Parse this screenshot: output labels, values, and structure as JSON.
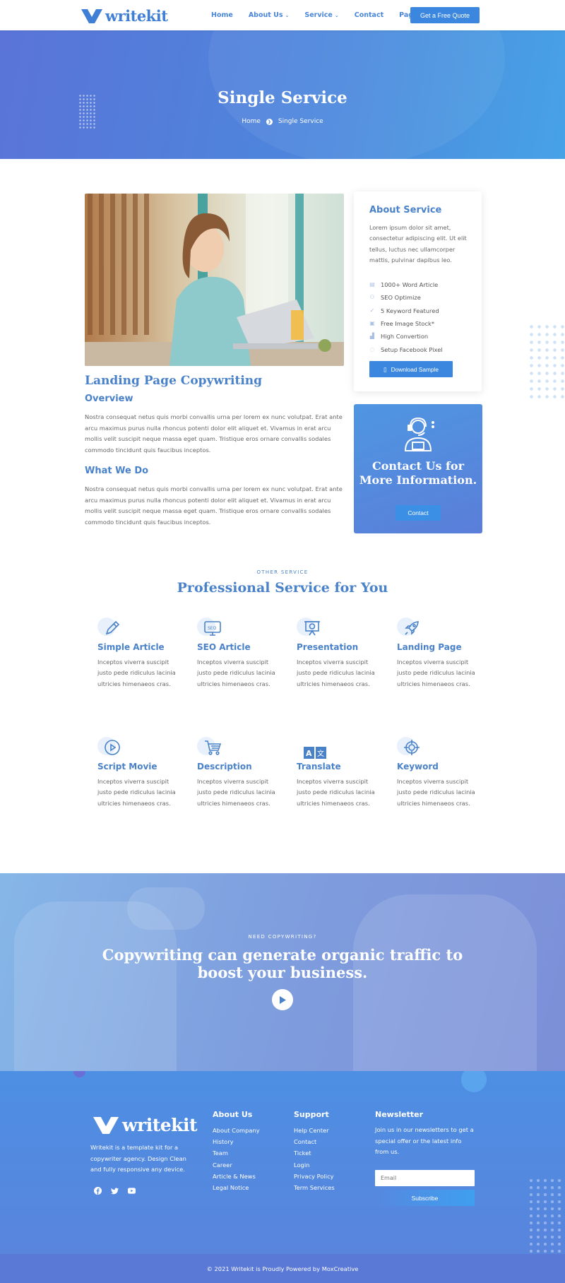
{
  "header": {
    "logo_text": "writekit",
    "nav": [
      {
        "label": "Home",
        "dropdown": false
      },
      {
        "label": "About Us",
        "dropdown": true
      },
      {
        "label": "Service",
        "dropdown": true
      },
      {
        "label": "Contact",
        "dropdown": false
      },
      {
        "label": "Page",
        "dropdown": true
      }
    ],
    "cta_label": "Get a Free Quote"
  },
  "hero": {
    "title": "Single Service",
    "breadcrumb_home": "Home",
    "breadcrumb_current": "Single Service"
  },
  "service": {
    "title": "Landing Page Copywriting",
    "overview_heading": "Overview",
    "overview_text": "Nostra consequat netus quis morbi convallis urna per lorem ex nunc volutpat. Erat ante arcu maximus purus nulla rhoncus potenti dolor elit aliquet et. Vivamus in erat arcu mollis velit suscipit neque massa eget quam. Tristique eros ornare convallis sodales commodo tincidunt quis faucibus inceptos.",
    "whatwedo_heading": "What We Do",
    "whatwedo_text": "Nostra consequat netus quis morbi convallis urna per lorem ex nunc volutpat. Erat ante arcu maximus purus nulla rhoncus potenti dolor elit aliquet et. Vivamus in erat arcu mollis velit suscipit neque massa eget quam. Tristique eros ornare convallis sodales commodo tincidunt quis faucibus inceptos."
  },
  "about_card": {
    "title": "About Service",
    "text": "Lorem ipsum dolor sit amet, consectetur adipiscing elit. Ut elit tellus, luctus nec ullamcorper mattis, pulvinar dapibus leo.",
    "features": [
      {
        "label": "1000+ Word Article",
        "icon": "document-icon"
      },
      {
        "label": " SEO Optimize",
        "icon": "users-icon"
      },
      {
        "label": "5 Keyword Featured",
        "icon": "check-icon"
      },
      {
        "label": "Free Image Stock*",
        "icon": "image-icon"
      },
      {
        "label": "High Convertion",
        "icon": "chart-icon"
      },
      {
        "label": "Setup Facebook Pixel",
        "icon": "circle-icon"
      }
    ],
    "button_label": "Download Sample"
  },
  "contact_card": {
    "title": "Contact Us for More Information.",
    "button_label": "Contact"
  },
  "services": {
    "eyebrow": "OTHER SERVICE",
    "heading": "Professional Service for You",
    "items": [
      {
        "title": "Simple Article",
        "desc": "Inceptos viverra suscipit justo pede ridiculus lacinia ultricies himenaeos cras.",
        "icon": "pen-icon"
      },
      {
        "title": "SEO Article",
        "desc": "Inceptos viverra suscipit justo pede ridiculus lacinia ultricies himenaeos cras.",
        "icon": "seo-icon"
      },
      {
        "title": "Presentation",
        "desc": "Inceptos viverra suscipit justo pede ridiculus lacinia ultricies himenaeos cras.",
        "icon": "presentation-icon"
      },
      {
        "title": "Landing Page",
        "desc": "Inceptos viverra suscipit justo pede ridiculus lacinia ultricies himenaeos cras.",
        "icon": "rocket-icon"
      },
      {
        "title": "Script Movie",
        "desc": "Inceptos viverra suscipit justo pede ridiculus lacinia ultricies himenaeos cras.",
        "icon": "play-circle-icon"
      },
      {
        "title": "Description",
        "desc": "Inceptos viverra suscipit justo pede ridiculus lacinia ultricies himenaeos cras.",
        "icon": "cart-icon"
      },
      {
        "title": "Translate",
        "desc": "Inceptos viverra suscipit justo pede ridiculus lacinia ultricies himenaeos cras.",
        "icon": "translate-icon"
      },
      {
        "title": "Keyword",
        "desc": "Inceptos viverra suscipit justo pede ridiculus lacinia ultricies himenaeos cras.",
        "icon": "target-icon"
      }
    ]
  },
  "cta": {
    "eyebrow": "NEED COPYWRITING?",
    "title": "Copywriting can generate organic traffic to boost your business."
  },
  "footer": {
    "logo_text": "writekit",
    "about": "Writekit is a template kit for a copywriter agency. Design Clean and fully responsive any device.",
    "social": [
      "facebook-icon",
      "twitter-icon",
      "youtube-icon"
    ],
    "about_us": {
      "heading": "About Us",
      "links": [
        "About Company",
        "History",
        "Team",
        "Career",
        "Article & News",
        "Legal Notice"
      ]
    },
    "support": {
      "heading": "Support",
      "links": [
        "Help Center",
        "Contact",
        "Ticket",
        "Login",
        "Privacy Policy",
        "Term Services"
      ]
    },
    "newsletter": {
      "heading": "Newsletter",
      "text": "Join us in our newsletters to get a special offer or the latest info from us.",
      "email_placeholder": "Email",
      "button_label": "Subscribe"
    },
    "copyright": "© 2021 Writekit is Proudly Powered by MoxCreative"
  },
  "colors": {
    "primary": "#4a82c9",
    "button": "#3b87e0",
    "hero_start": "#5a74d8",
    "hero_end": "#47a2e6"
  }
}
